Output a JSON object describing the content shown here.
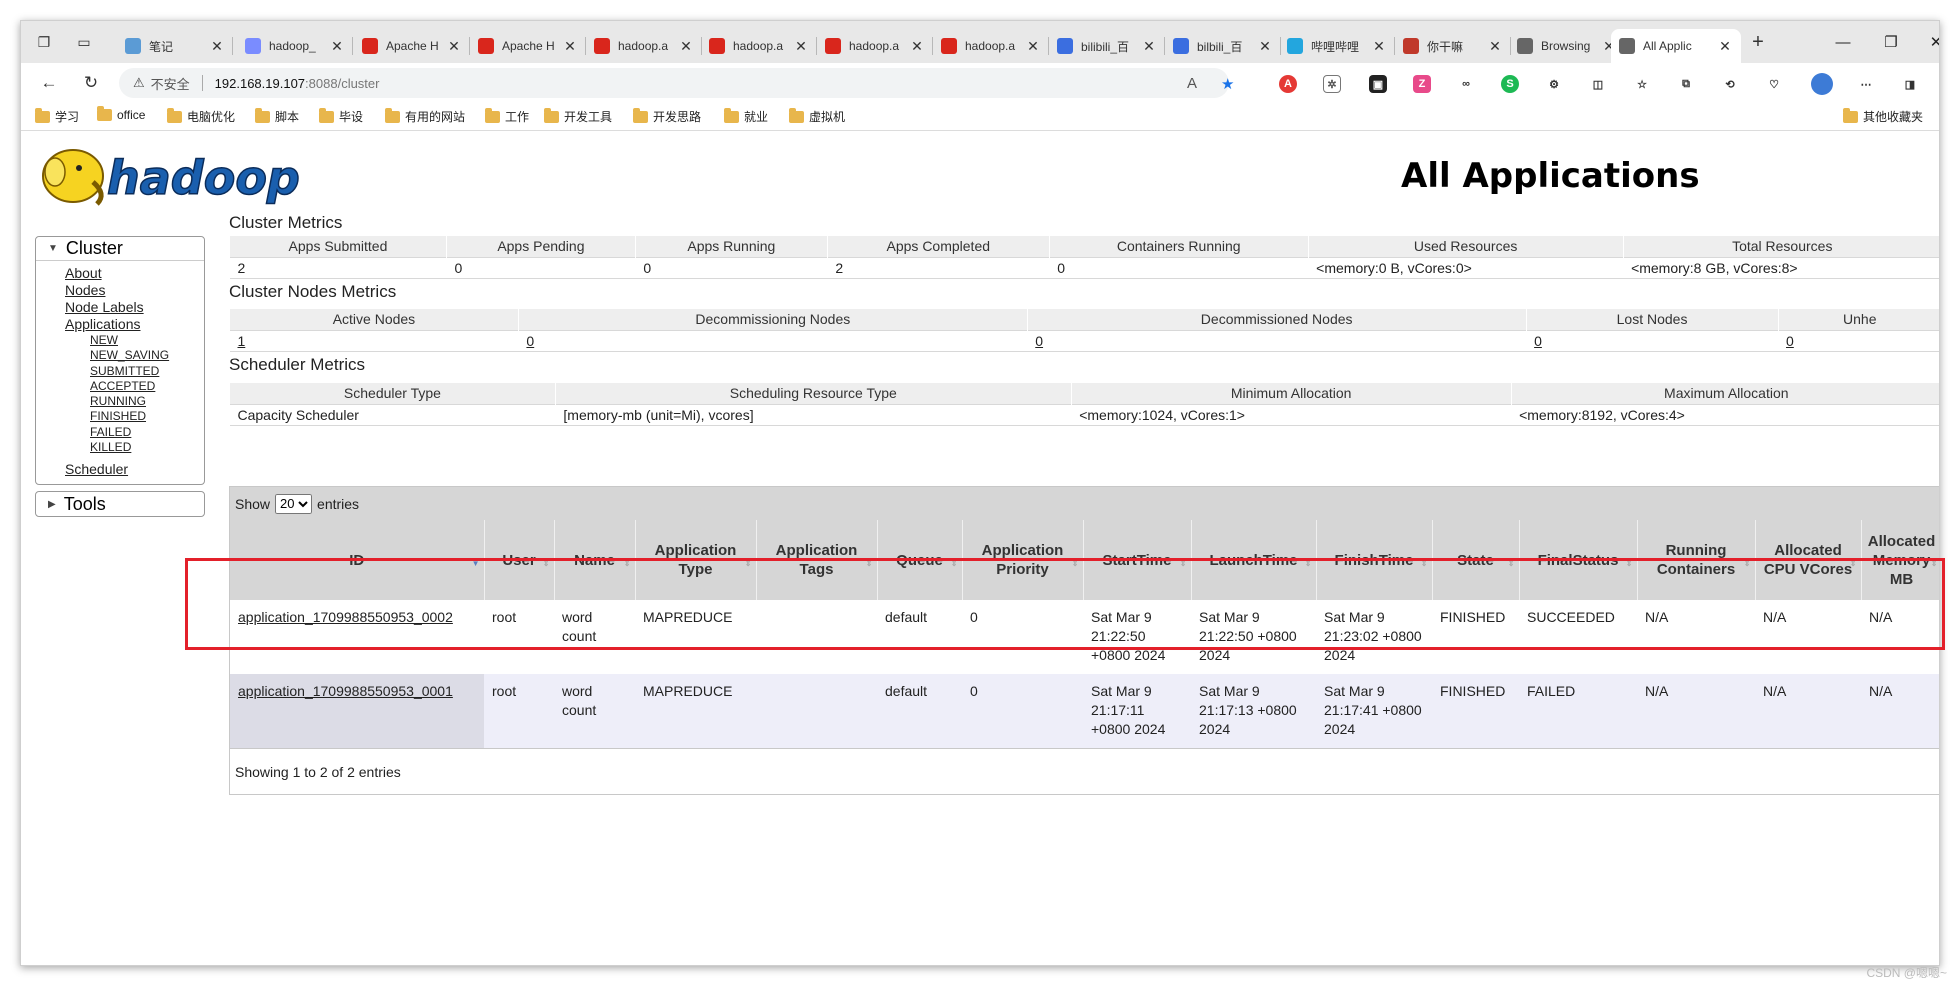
{
  "browser": {
    "tabs": [
      {
        "title": "笔记",
        "color": "#5b9bd5"
      },
      {
        "title": "hadoop_",
        "color": "#7a8cff"
      },
      {
        "title": "Apache H",
        "color": "#d9261c"
      },
      {
        "title": "Apache H",
        "color": "#d9261c"
      },
      {
        "title": "hadoop.a",
        "color": "#d9261c"
      },
      {
        "title": "hadoop.a",
        "color": "#d9261c"
      },
      {
        "title": "hadoop.a",
        "color": "#d9261c"
      },
      {
        "title": "hadoop.a",
        "color": "#d9261c"
      },
      {
        "title": "bilibili_百",
        "color": "#3b6ee0"
      },
      {
        "title": "bilbili_百",
        "color": "#3b6ee0"
      },
      {
        "title": "哔哩哔哩",
        "color": "#23a6de"
      },
      {
        "title": "你干嘛",
        "color": "#c0392b"
      },
      {
        "title": "Browsing",
        "color": "#666666"
      },
      {
        "title": "All Applic",
        "color": "#666666"
      }
    ],
    "new_tab_glyph": "+",
    "url_warning": "不安全",
    "url_host": "192.168.19.107",
    "url_path": ":8088/cluster",
    "bookmarks": [
      "学习",
      "office",
      "电脑优化",
      "脚本",
      "毕设",
      "有用的网站",
      "工作",
      "开发工具",
      "开发思路",
      "就业",
      "虚拟机"
    ],
    "other_bookmarks": "其他收藏夹"
  },
  "page": {
    "title": "All Applications",
    "logo_text": "hadoop"
  },
  "nav": {
    "cluster_label": "Cluster",
    "tools_label": "Tools",
    "links": [
      "About",
      "Nodes",
      "Node Labels",
      "Applications"
    ],
    "app_states": [
      "NEW",
      "NEW_SAVING",
      "SUBMITTED",
      "ACCEPTED",
      "RUNNING",
      "FINISHED",
      "FAILED",
      "KILLED"
    ],
    "scheduler": "Scheduler"
  },
  "cluster_metrics": {
    "title": "Cluster Metrics",
    "headers": [
      "Apps Submitted",
      "Apps Pending",
      "Apps Running",
      "Apps Completed",
      "Containers Running",
      "Used Resources",
      "Total Resources"
    ],
    "values": [
      "2",
      "0",
      "0",
      "2",
      "0",
      "<memory:0 B, vCores:0>",
      "<memory:8 GB, vCores:8>"
    ]
  },
  "nodes_metrics": {
    "title": "Cluster Nodes Metrics",
    "headers": [
      "Active Nodes",
      "Decommissioning Nodes",
      "Decommissioned Nodes",
      "Lost Nodes",
      "Unhe"
    ],
    "values": [
      "1",
      "0",
      "0",
      "0",
      "0"
    ]
  },
  "scheduler_metrics": {
    "title": "Scheduler Metrics",
    "headers": [
      "Scheduler Type",
      "Scheduling Resource Type",
      "Minimum Allocation",
      "Maximum Allocation"
    ],
    "values": [
      "Capacity Scheduler",
      "[memory-mb (unit=Mi), vcores]",
      "<memory:1024, vCores:1>",
      "<memory:8192, vCores:4>"
    ]
  },
  "apps": {
    "show_label": "Show",
    "page_size": "20",
    "entries_label": "entries",
    "headers": [
      "ID",
      "User",
      "Name",
      "Application Type",
      "Application Tags",
      "Queue",
      "Application Priority",
      "StartTime",
      "LaunchTime",
      "FinishTime",
      "State",
      "FinalStatus",
      "Running Containers",
      "Allocated CPU VCores",
      "Allocated Memory MB"
    ],
    "rows": [
      {
        "id": "application_1709988550953_0002",
        "user": "root",
        "name": "word count",
        "type": "MAPREDUCE",
        "tags": "",
        "queue": "default",
        "priority": "0",
        "start": "Sat Mar 9 21:22:50 +0800 2024",
        "launch": "Sat Mar 9 21:22:50 +0800 2024",
        "finish": "Sat Mar 9 21:23:02 +0800 2024",
        "state": "FINISHED",
        "final": "SUCCEEDED",
        "running": "N/A",
        "cpu": "N/A",
        "mem": "N/A"
      },
      {
        "id": "application_1709988550953_0001",
        "user": "root",
        "name": "word count",
        "type": "MAPREDUCE",
        "tags": "",
        "queue": "default",
        "priority": "0",
        "start": "Sat Mar 9 21:17:11 +0800 2024",
        "launch": "Sat Mar 9 21:17:13 +0800 2024",
        "finish": "Sat Mar 9 21:17:41 +0800 2024",
        "state": "FINISHED",
        "final": "FAILED",
        "running": "N/A",
        "cpu": "N/A",
        "mem": "N/A"
      }
    ],
    "footer": "Showing 1 to 2 of 2 entries"
  },
  "watermark": "CSDN @嗯嗯~",
  "colors": {
    "highlight": "#e3202a",
    "header_bg": "#d6d6d6",
    "metrics_header_bg": "#eeeeee",
    "even_row_bg": "#eeeef9"
  }
}
